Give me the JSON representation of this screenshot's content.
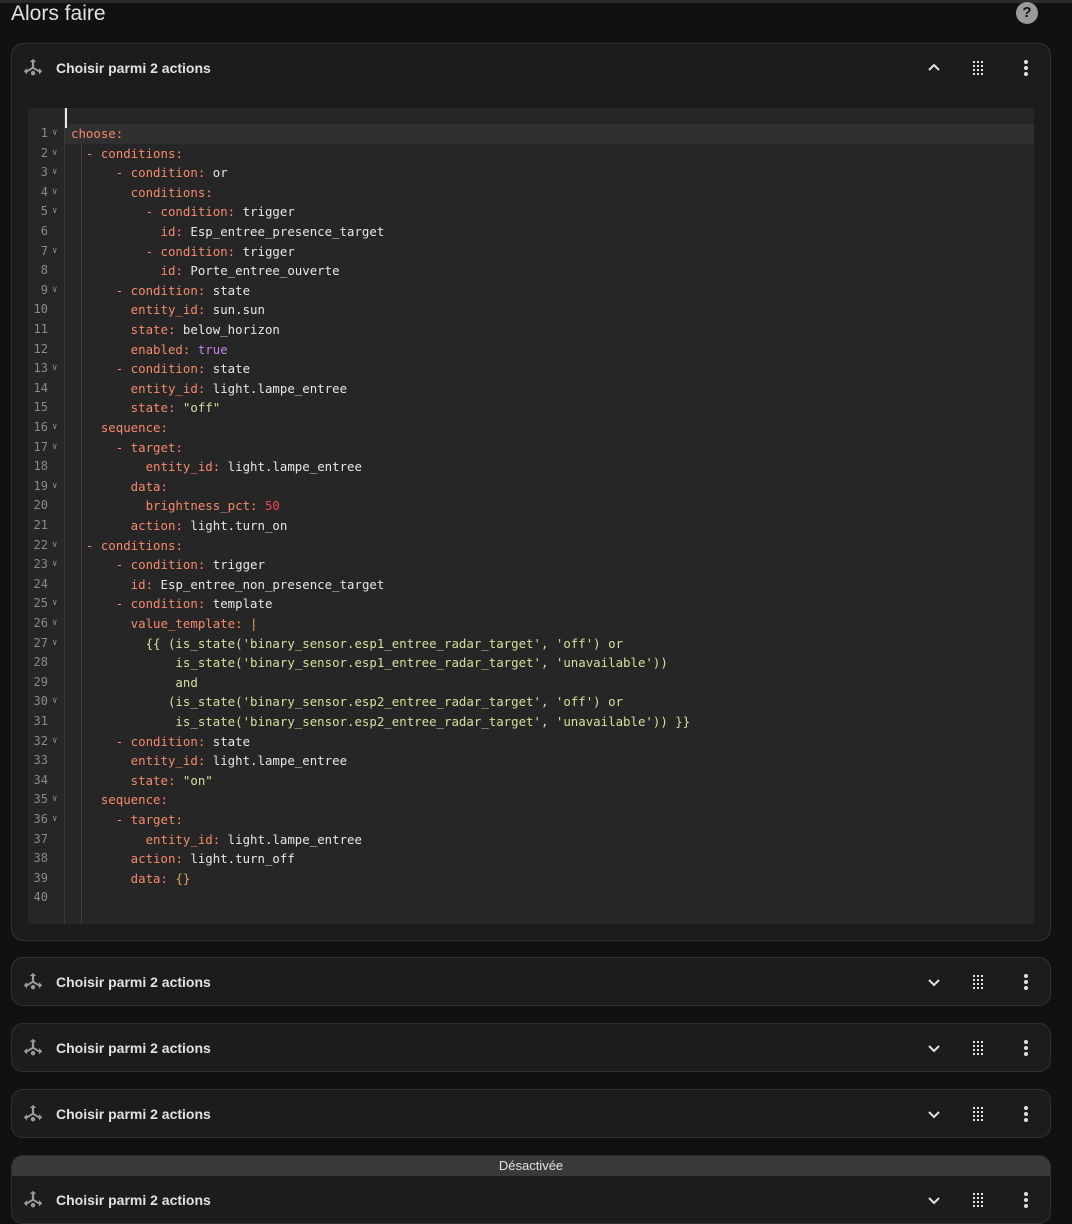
{
  "section": {
    "title": "Alors faire",
    "help_icon": "help-circle-icon",
    "help_glyph": "?"
  },
  "expanded_card": {
    "title": "Choisir parmi 2 actions",
    "icon": "choose-arrows-icon",
    "expand_icon": "chevron-up-icon",
    "drag_icon": "drag-handle-icon",
    "menu_icon": "dots-vertical-icon"
  },
  "code": {
    "line_numbers": [
      "1",
      "2",
      "3",
      "4",
      "5",
      "6",
      "7",
      "8",
      "9",
      "10",
      "11",
      "12",
      "13",
      "14",
      "15",
      "16",
      "17",
      "18",
      "19",
      "20",
      "21",
      "22",
      "23",
      "24",
      "25",
      "26",
      "27",
      "28",
      "29",
      "30",
      "31",
      "32",
      "33",
      "34",
      "35",
      "36",
      "37",
      "38",
      "39",
      "40"
    ],
    "fold_lines": [
      1,
      2,
      3,
      4,
      5,
      7,
      9,
      13,
      16,
      17,
      19,
      22,
      23,
      25,
      26,
      27,
      30,
      32,
      35,
      36
    ],
    "lines": [
      [
        [
          "k",
          "choose"
        ],
        [
          "k",
          ":"
        ]
      ],
      [
        [
          "k",
          "  - conditions"
        ],
        [
          "k",
          ":"
        ]
      ],
      [
        [
          "k",
          "      - condition"
        ],
        [
          "k",
          ": "
        ],
        [
          "t",
          "or"
        ]
      ],
      [
        [
          "k",
          "        conditions"
        ],
        [
          "k",
          ":"
        ]
      ],
      [
        [
          "k",
          "          - condition"
        ],
        [
          "k",
          ": "
        ],
        [
          "t",
          "trigger"
        ]
      ],
      [
        [
          "k",
          "            id"
        ],
        [
          "k",
          ": "
        ],
        [
          "t",
          "Esp_entree_presence_target"
        ]
      ],
      [
        [
          "k",
          "          - condition"
        ],
        [
          "k",
          ": "
        ],
        [
          "t",
          "trigger"
        ]
      ],
      [
        [
          "k",
          "            id"
        ],
        [
          "k",
          ": "
        ],
        [
          "t",
          "Porte_entree_ouverte"
        ]
      ],
      [
        [
          "k",
          "      - condition"
        ],
        [
          "k",
          ": "
        ],
        [
          "t",
          "state"
        ]
      ],
      [
        [
          "k",
          "        entity_id"
        ],
        [
          "k",
          ": "
        ],
        [
          "t",
          "sun.sun"
        ]
      ],
      [
        [
          "k",
          "        state"
        ],
        [
          "k",
          ": "
        ],
        [
          "t",
          "below_horizon"
        ]
      ],
      [
        [
          "k",
          "        enabled"
        ],
        [
          "k",
          ": "
        ],
        [
          "b",
          "true"
        ]
      ],
      [
        [
          "k",
          "      - condition"
        ],
        [
          "k",
          ": "
        ],
        [
          "t",
          "state"
        ]
      ],
      [
        [
          "k",
          "        entity_id"
        ],
        [
          "k",
          ": "
        ],
        [
          "t",
          "light.lampe_entree"
        ]
      ],
      [
        [
          "k",
          "        state"
        ],
        [
          "k",
          ": "
        ],
        [
          "s",
          "\"off\""
        ]
      ],
      [
        [
          "k",
          "    sequence"
        ],
        [
          "k",
          ":"
        ]
      ],
      [
        [
          "k",
          "      - target"
        ],
        [
          "k",
          ":"
        ]
      ],
      [
        [
          "k",
          "          entity_id"
        ],
        [
          "k",
          ": "
        ],
        [
          "t",
          "light.lampe_entree"
        ]
      ],
      [
        [
          "k",
          "        data"
        ],
        [
          "k",
          ":"
        ]
      ],
      [
        [
          "k",
          "          brightness_pct"
        ],
        [
          "k",
          ": "
        ],
        [
          "n",
          "50"
        ]
      ],
      [
        [
          "k",
          "        action"
        ],
        [
          "k",
          ": "
        ],
        [
          "t",
          "light.turn_on"
        ]
      ],
      [
        [
          "k",
          "  - conditions"
        ],
        [
          "k",
          ":"
        ]
      ],
      [
        [
          "k",
          "      - condition"
        ],
        [
          "k",
          ": "
        ],
        [
          "t",
          "trigger"
        ]
      ],
      [
        [
          "k",
          "        id"
        ],
        [
          "k",
          ": "
        ],
        [
          "t",
          "Esp_entree_non_presence_target"
        ]
      ],
      [
        [
          "k",
          "      - condition"
        ],
        [
          "k",
          ": "
        ],
        [
          "t",
          "template"
        ]
      ],
      [
        [
          "k",
          "        value_template"
        ],
        [
          "k",
          ": "
        ],
        [
          "p",
          "|"
        ]
      ],
      [
        [
          "s",
          "          {{ (is_state('binary_sensor.esp1_entree_radar_target', 'off') or"
        ]
      ],
      [
        [
          "s",
          "              is_state('binary_sensor.esp1_entree_radar_target', 'unavailable'))"
        ]
      ],
      [
        [
          "s",
          "              and"
        ]
      ],
      [
        [
          "s",
          "             (is_state('binary_sensor.esp2_entree_radar_target', 'off') or"
        ]
      ],
      [
        [
          "s",
          "              is_state('binary_sensor.esp2_entree_radar_target', 'unavailable')) }}"
        ]
      ],
      [
        [
          "k",
          "      - condition"
        ],
        [
          "k",
          ": "
        ],
        [
          "t",
          "state"
        ]
      ],
      [
        [
          "k",
          "        entity_id"
        ],
        [
          "k",
          ": "
        ],
        [
          "t",
          "light.lampe_entree"
        ]
      ],
      [
        [
          "k",
          "        state"
        ],
        [
          "k",
          ": "
        ],
        [
          "s",
          "\"on\""
        ]
      ],
      [
        [
          "k",
          "    sequence"
        ],
        [
          "k",
          ":"
        ]
      ],
      [
        [
          "k",
          "      - target"
        ],
        [
          "k",
          ":"
        ]
      ],
      [
        [
          "k",
          "          entity_id"
        ],
        [
          "k",
          ": "
        ],
        [
          "t",
          "light.lampe_entree"
        ]
      ],
      [
        [
          "k",
          "        action"
        ],
        [
          "k",
          ": "
        ],
        [
          "t",
          "light.turn_off"
        ]
      ],
      [
        [
          "k",
          "        data"
        ],
        [
          "k",
          ": "
        ],
        [
          "p",
          "{}"
        ]
      ],
      [
        [
          "t",
          ""
        ]
      ]
    ]
  },
  "collapsed_cards": [
    {
      "title": "Choisir parmi 2 actions",
      "disabled_label": ""
    },
    {
      "title": "Choisir parmi 2 actions",
      "disabled_label": ""
    },
    {
      "title": "Choisir parmi 2 actions",
      "disabled_label": ""
    },
    {
      "title": "Choisir parmi 2 actions",
      "disabled_label": "Désactivée"
    }
  ],
  "collapsed_expand_icon": "chevron-down-icon",
  "colors": {
    "background": "#111111",
    "card": "#1c1c1c",
    "editor": "#262626",
    "key": "#f5896c",
    "string": "#d4e09b",
    "number": "#f14b52",
    "boolean": "#c586e8"
  }
}
